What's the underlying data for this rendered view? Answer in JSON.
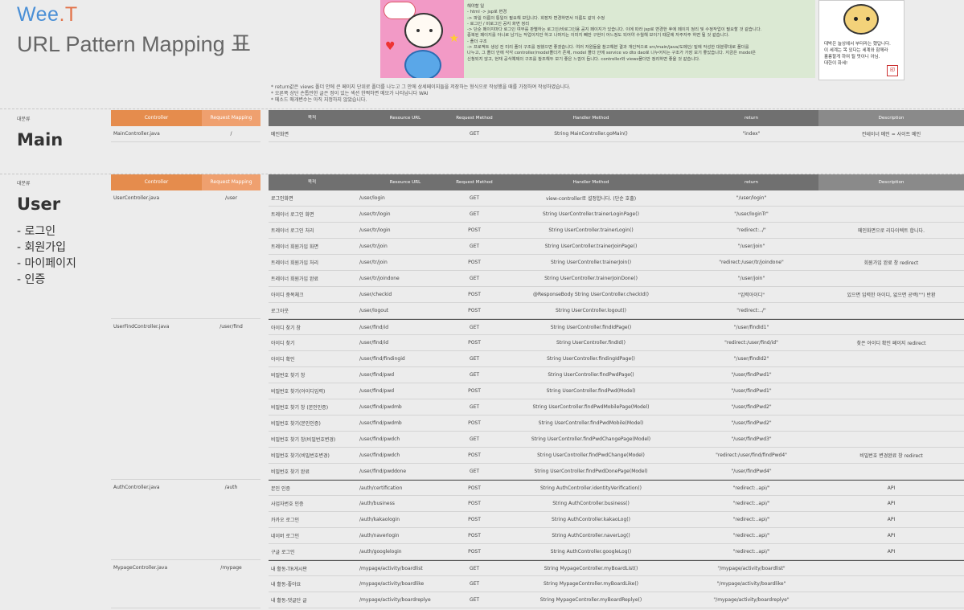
{
  "brand": {
    "part1": "Wee",
    "dot": ".",
    "part2": "T"
  },
  "title": "URL Pattern Mapping 표",
  "note_box_lines": [
    "해야할 일",
    "- html -> jsp로 변경",
    "  -> 파일 이름의 통일이 필요해 보입니다. 회장자 변경하면서 이름도 같이 수정",
    "- 로그인 / 비로그인 공지 화면 정리",
    "  -> 단순 페이지마다 로그인 여부를 판별하는 로그인/비로그인용 공지 페이지가 있습니다. 이에 따라 jsp로 변경한 후에 페이지 정리 및 수정작업이 필요할 것 같습니다.",
    "  중복된 페이지를 아니로 남기는 작업이지만 하고 나머지는 이미지 빼만 구현이 어느정도 되어야 수월해 보이기 때문에 자주자주 하면 될 것 같습니다.",
    "- 폴더 구조",
    "  -> 프로젝트 생성 전 미리 폴더 구조를 정했으면 좋겠습니다. 여러 자원들을 참고해본 결과 개인적으로 src/main/java/도메인/ 밑에 작성한 대분류대로 폴더를",
    "  나누고, 그 폴더 안에 각각 controller/model폴더가 존재, model 폴더 안에 service vo dto dao로 나누어지는 구조가 가장 보기 좋았습니다. 지금은 model은",
    "  신청되지 않고, 현재 공식예제의 구조를 참조해두 보기 좋은 느낌이 듭니다. controller와 views폴더만 정리하면 좋을 것 같습니다."
  ],
  "card_text": [
    "대박은 늘상에서 부터라는 했답니다.",
    "이 세계는 목 있다는 세계와 함께라",
    "훌륭할게 하여 될 멋이니 아님.",
    "대한이 화세!"
  ],
  "notes": [
    "* return값은 views 폴더 안에 큰 페이지 단위로 폴더를 나누고 그 안에 상세페이지들을 저장하는 형식으로 작성했을 때를 가정하여 작성하였습니다.",
    "* 오른쪽 상단 손톱만한 글은 정이 있는 섹션 한쩍하면 메모가 나타납니다 WAI",
    "* 메소드 매개변수는 아직 지정하지 않았습니다."
  ],
  "lt_headers": {
    "controller": "Controller",
    "mapping": "Request Mapping"
  },
  "rt_headers": {
    "purpose": "목적",
    "url": "Resource URL",
    "method": "Request Method",
    "handler": "Handler Method",
    "ret": "return",
    "desc": "Description"
  },
  "main": {
    "category": "대분류",
    "name": "Main",
    "controllers": [
      {
        "name": "MainController.java",
        "mapping": "/"
      }
    ],
    "rows": [
      {
        "purpose": "메인화면",
        "url": "",
        "method": "GET",
        "handler": "String MainController.goMain()",
        "ret": "\"index\"",
        "desc": "컨테이너 메인 = 사이트 메인"
      }
    ]
  },
  "user": {
    "category": "대분류",
    "name": "User",
    "subs": [
      "- 로그인",
      "- 회원가입",
      "- 마이페이지",
      "- 인증"
    ],
    "controllers": [
      {
        "name": "UserController.java",
        "mapping": "/user",
        "span": 8
      },
      {
        "name": "UserFindController.java",
        "mapping": "/user/find",
        "span": 10
      },
      {
        "name": "AuthController.java",
        "mapping": "/auth",
        "span": 5
      },
      {
        "name": "MypageController.java",
        "mapping": "/mypage",
        "span": 3
      }
    ],
    "rows": [
      {
        "purpose": "로그인화면",
        "url": "/user/login",
        "method": "GET",
        "handler": "view-controller로 설정합니다. (단순 호출)",
        "ret": "\"/user/login\"",
        "desc": ""
      },
      {
        "purpose": "트레이너 로그인 화면",
        "url": "/user/tr/login",
        "method": "GET",
        "handler": "String UserController.trainerLoginPage()",
        "ret": "\"/user/loginTr\"",
        "desc": ""
      },
      {
        "purpose": "트레이너 로그인 처리",
        "url": "/user/tr/login",
        "method": "POST",
        "handler": "String UserController.trainerLogin()",
        "ret": "\"redirect:../\"",
        "desc": "메인화면으로 리다이렉트 합니다."
      },
      {
        "purpose": "트레이너 회원가입 화면",
        "url": "/user/tr/join",
        "method": "GET",
        "handler": "String UserController.trainerJoinPage()",
        "ret": "\"/user/join\"",
        "desc": ""
      },
      {
        "purpose": "트레이너 회원가입 처리",
        "url": "/user/tr/join",
        "method": "POST",
        "handler": "String UserController.trainerJoin()",
        "ret": "\"redirect:/user/tr/joindone\"",
        "desc": "회원가입 완료 창 redirect"
      },
      {
        "purpose": "트레이너 회원가입 완료",
        "url": "/user/tr/joindone",
        "method": "GET",
        "handler": "String UserController.trainerJoinDone()",
        "ret": "\"/user/join\"",
        "desc": ""
      },
      {
        "purpose": "아이디 중복체크",
        "url": "/user/checkid",
        "method": "POST",
        "handler": "@ResponseBody String UserController.checkId()",
        "ret": "\"입력아이디\"",
        "desc": "있으면 입력한 아이디, 없으면 공백(\"\") 반환"
      },
      {
        "purpose": "로그아웃",
        "url": "/user/logout",
        "method": "POST",
        "handler": "String UserController.logout()",
        "ret": "\"redirect:../\"",
        "desc": ""
      },
      {
        "purpose": "아이디 찾기 창",
        "url": "/user/find/id",
        "method": "GET",
        "handler": "String UserController.findIdPage()",
        "ret": "\"/user/findId1\"",
        "desc": ""
      },
      {
        "purpose": "아이디 찾기",
        "url": "/user/find/id",
        "method": "POST",
        "handler": "String UserController.findId()",
        "ret": "\"redirect:/user/find/id\"",
        "desc": "찾은 아이디 확인 페이지 redirect"
      },
      {
        "purpose": "아이디 확인",
        "url": "/user/find/findingid",
        "method": "GET",
        "handler": "String UserController.findingIdPage()",
        "ret": "\"/user/findId2\"",
        "desc": ""
      },
      {
        "purpose": "비밀번호 찾기 창",
        "url": "/user/find/pwd",
        "method": "GET",
        "handler": "String UserController.findPwdPage()",
        "ret": "\"/user/findPwd1\"",
        "desc": ""
      },
      {
        "purpose": "비밀번호 찾기(아이디입력)",
        "url": "/user/find/pwd",
        "method": "POST",
        "handler": "String UserController.findPwd(Model)",
        "ret": "\"/user/findPwd1\"",
        "desc": ""
      },
      {
        "purpose": "비밀번호 찾기 창 (본인인증)",
        "url": "/user/find/pwdmb",
        "method": "GET",
        "handler": "String UserController.findPwdMobilePage(Model)",
        "ret": "\"/user/findPwd2\"",
        "desc": ""
      },
      {
        "purpose": "비밀번호 찾기(본인인증)",
        "url": "/user/find/pwdmb",
        "method": "POST",
        "handler": "String UserController.findPwdMobile(Model)",
        "ret": "\"/user/findPwd2\"",
        "desc": ""
      },
      {
        "purpose": "비밀번호 찾기 창(비밀번호변경)",
        "url": "/user/find/pwdch",
        "method": "GET",
        "handler": "String UserController.findPwdChangePage(Model)",
        "ret": "\"/user/findPwd3\"",
        "desc": ""
      },
      {
        "purpose": "비밀번호 찾기(비밀번호변경)",
        "url": "/user/find/pwdch",
        "method": "POST",
        "handler": "String UserController.findPwdChange(Model)",
        "ret": "\"redirect:/user/find/findPwd4\"",
        "desc": "비밀번호 변경완료 창 redirect"
      },
      {
        "purpose": "비밀번호 찾기 완료",
        "url": "/user/find/pwddone",
        "method": "GET",
        "handler": "String UserController.findPwdDonePage(Model)",
        "ret": "\"/user/findPwd4\"",
        "desc": ""
      },
      {
        "purpose": "본인 인증",
        "url": "/auth/certification",
        "method": "POST",
        "handler": "String AuthController.identityVerification()",
        "ret": "\"redirect:..api/\"",
        "desc": "API"
      },
      {
        "purpose": "사업자번호 인증",
        "url": "/auth/business",
        "method": "POST",
        "handler": "String AuthController.business()",
        "ret": "\"redirect:..api/\"",
        "desc": "API"
      },
      {
        "purpose": "카카오 로그인",
        "url": "/auth/kakaologin",
        "method": "POST",
        "handler": "String AuthController.kakaoLog()",
        "ret": "\"redirect:..api/\"",
        "desc": "API"
      },
      {
        "purpose": "네이버 로그인",
        "url": "/auth/naverlogin",
        "method": "POST",
        "handler": "String AuthController.naverLog()",
        "ret": "\"redirect:..api/\"",
        "desc": "API"
      },
      {
        "purpose": "구글 로그인",
        "url": "/auth/googlelogin",
        "method": "POST",
        "handler": "String AuthController.googleLog()",
        "ret": "\"redirect:..api/\"",
        "desc": "API"
      },
      {
        "purpose": "내 활동-TR게시판",
        "url": "/mypage/activity/boardlist",
        "method": "GET",
        "handler": "String MypageController.myBoardList()",
        "ret": "\"/mypage/activity/boardlist\"",
        "desc": ""
      },
      {
        "purpose": "내 활동-좋아요",
        "url": "/mypage/activity/boardlike",
        "method": "GET",
        "handler": "String MypageController.myBoardLike()",
        "ret": "\"/mypage/activity/boardlike\"",
        "desc": ""
      },
      {
        "purpose": "내 활동-댓글단 글",
        "url": "/mypage/activity/boardreplye",
        "method": "GET",
        "handler": "String MypageController.myBoardReplye()",
        "ret": "\"/mypage/activity/boardreplye\"",
        "desc": ""
      }
    ]
  }
}
